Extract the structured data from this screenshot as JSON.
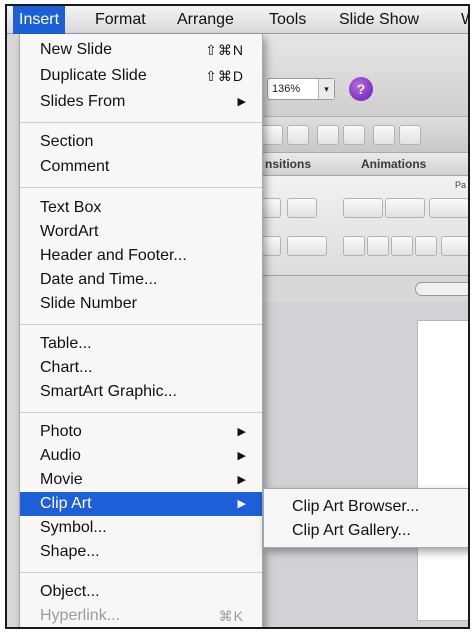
{
  "menubar": {
    "items": [
      "Insert",
      "Format",
      "Arrange",
      "Tools",
      "Slide Show",
      "W"
    ]
  },
  "toolbar": {
    "zoom_value": "136%",
    "help_label": "?"
  },
  "ribbon": {
    "tabs": [
      "nsitions",
      "Animations"
    ],
    "partial_label": "Pa"
  },
  "insert_menu": {
    "groups": [
      [
        {
          "label": "New Slide",
          "shortcut": "⇧⌘N"
        },
        {
          "label": "Duplicate Slide",
          "shortcut": "⇧⌘D"
        },
        {
          "label": "Slides From",
          "submenu": true
        }
      ],
      [
        {
          "label": "Section"
        },
        {
          "label": "Comment"
        }
      ],
      [
        {
          "label": "Text Box"
        },
        {
          "label": "WordArt"
        },
        {
          "label": "Header and Footer..."
        },
        {
          "label": "Date and Time..."
        },
        {
          "label": "Slide Number"
        }
      ],
      [
        {
          "label": "Table..."
        },
        {
          "label": "Chart..."
        },
        {
          "label": "SmartArt Graphic..."
        }
      ],
      [
        {
          "label": "Photo",
          "submenu": true
        },
        {
          "label": "Audio",
          "submenu": true
        },
        {
          "label": "Movie",
          "submenu": true
        },
        {
          "label": "Clip Art",
          "submenu": true,
          "highlighted": true
        },
        {
          "label": "Symbol..."
        },
        {
          "label": "Shape..."
        }
      ],
      [
        {
          "label": "Object..."
        },
        {
          "label": "Hyperlink...",
          "shortcut": "⌘K",
          "disabled": true
        }
      ]
    ]
  },
  "clip_art_submenu": {
    "items": [
      "Clip Art Browser...",
      "Clip Art Gallery..."
    ]
  },
  "colors": {
    "highlight": "#1c5fd6",
    "help_button": "#8a2be2"
  }
}
